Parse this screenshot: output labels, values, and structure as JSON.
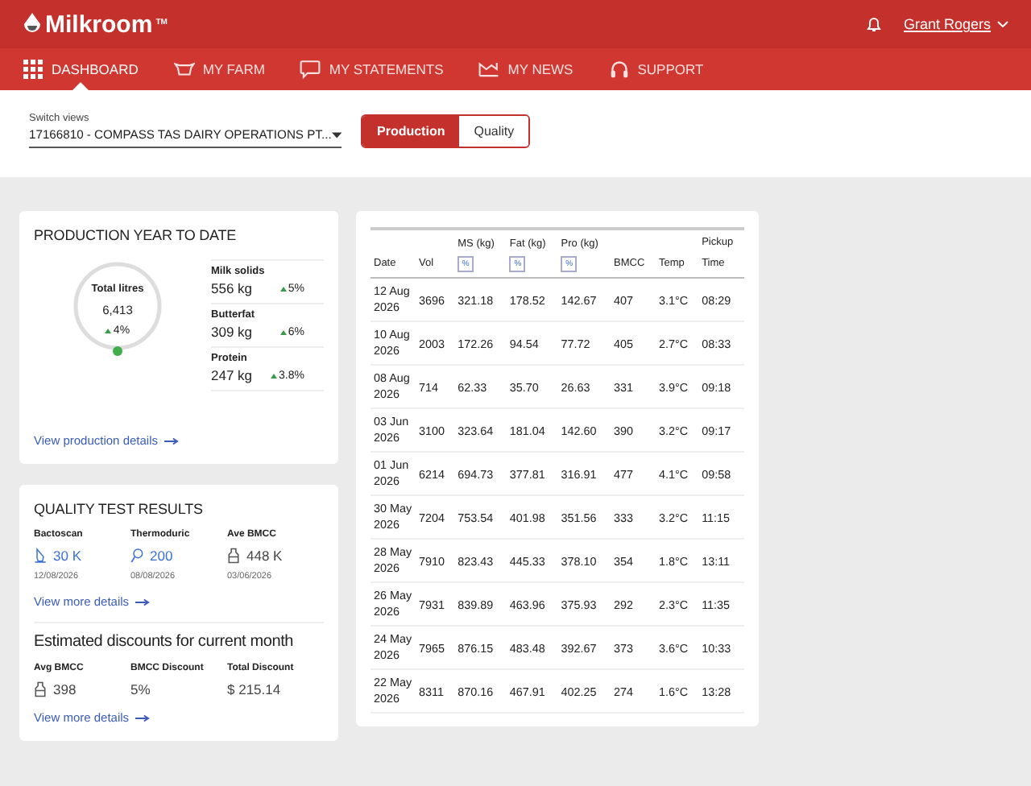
{
  "header": {
    "logo": "Milkroom",
    "trademark": "TM",
    "user": "Grant Rogers"
  },
  "nav": [
    {
      "label": "DASHBOARD",
      "selected": true
    },
    {
      "label": "MY FARM",
      "selected": false
    },
    {
      "label": "MY STATEMENTS",
      "selected": false
    },
    {
      "label": "MY NEWS",
      "selected": false
    },
    {
      "label": "SUPPORT",
      "selected": false
    }
  ],
  "switch_views": {
    "label": "Switch views",
    "value": "17166810 - COMPASS TAS DAIRY OPERATIONS PT..."
  },
  "toggle": [
    {
      "label": "Production",
      "selected": true
    },
    {
      "label": "Quality",
      "selected": false
    }
  ],
  "production": {
    "title": "PRODUCTION YEAR TO DATE",
    "total_label": "Total litres",
    "total_value": "6,413",
    "total_change": "4%",
    "metrics": [
      {
        "label": "Milk solids",
        "value": "556 kg",
        "change": "5%"
      },
      {
        "label": "Butterfat",
        "value": "309 kg",
        "change": "6%"
      },
      {
        "label": "Protein",
        "value": "247 kg",
        "change": "3.8%"
      }
    ],
    "link": "View production details"
  },
  "quality": {
    "title": "QUALITY TEST RESULTS",
    "tests": [
      {
        "label": "Bactoscan",
        "value": "30 K",
        "date": "12/08/2026",
        "linked": true
      },
      {
        "label": "Thermoduric",
        "value": "200",
        "date": "08/08/2026",
        "linked": true
      },
      {
        "label": "Ave BMCC",
        "value": "448 K",
        "date": "03/06/2026",
        "linked": false
      }
    ],
    "link": "View more details",
    "discount_title": "Estimated discounts for current month",
    "discounts": [
      {
        "label": "Avg BMCC",
        "value": "398"
      },
      {
        "label": "BMCC Discount",
        "value": "5%"
      },
      {
        "label": "Total Discount",
        "value": "$ 215.14"
      }
    ],
    "link2": "View more details"
  },
  "table": {
    "columns": [
      {
        "label": "Date"
      },
      {
        "label": "Vol"
      },
      {
        "group": "MS (kg)",
        "toggle": "%"
      },
      {
        "group": "Fat (kg)",
        "toggle": "%"
      },
      {
        "group": "Pro (kg)",
        "toggle": "%"
      },
      {
        "label": "BMCC"
      },
      {
        "label": "Temp"
      },
      {
        "label": "Time",
        "group": "Pickup"
      }
    ],
    "rows": [
      [
        "12 Aug 2026",
        "3696",
        "321.18",
        "178.52",
        "142.67",
        "407",
        "3.1°C",
        "08:29"
      ],
      [
        "10 Aug 2026",
        "2003",
        "172.26",
        "94.54",
        "77.72",
        "405",
        "2.7°C",
        "08:33"
      ],
      [
        "08 Aug 2026",
        "714",
        "62.33",
        "35.70",
        "26.63",
        "331",
        "3.9°C",
        "09:18"
      ],
      [
        "03 Jun 2026",
        "3100",
        "323.64",
        "181.04",
        "142.60",
        "390",
        "3.2°C",
        "09:17"
      ],
      [
        "01 Jun 2026",
        "6214",
        "694.73",
        "377.81",
        "316.91",
        "477",
        "4.1°C",
        "09:58"
      ],
      [
        "30 May 2026",
        "7204",
        "753.54",
        "401.98",
        "351.56",
        "333",
        "3.2°C",
        "11:15"
      ],
      [
        "28 May 2026",
        "7910",
        "823.43",
        "445.33",
        "378.10",
        "354",
        "1.8°C",
        "13:11"
      ],
      [
        "26 May 2026",
        "7931",
        "839.89",
        "463.96",
        "375.93",
        "292",
        "2.3°C",
        "11:35"
      ],
      [
        "24 May 2026",
        "7965",
        "876.15",
        "483.48",
        "392.67",
        "373",
        "3.6°C",
        "10:33"
      ],
      [
        "22 May 2026",
        "8311",
        "870.16",
        "467.91",
        "402.25",
        "274",
        "1.6°C",
        "13:28"
      ]
    ]
  }
}
